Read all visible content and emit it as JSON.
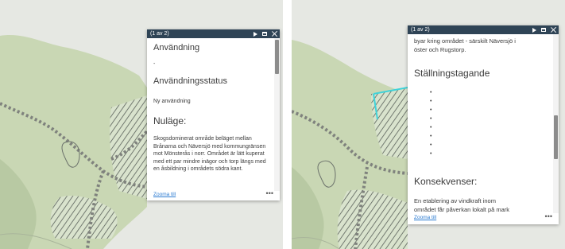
{
  "left_popup": {
    "counter": "(1 av 2)",
    "headings": [
      "Användning",
      "Användningsstatus",
      "Nuläge:"
    ],
    "anvandning_value": "-",
    "status_value": "Ny användning",
    "nulage_text": "Skogsdominerat område beläget mellan Brånarna och Näversjö med kommungränsen mot Mönsterås i norr. Området är lätt kuperat med ett par mindre inägor och torp längs med en åsbildning i områdets södra kant.",
    "zoom_link": "Zooma till"
  },
  "right_popup": {
    "counter": "(1 av 2)",
    "top_text_line1": "byar kring området - särskilt Näversjö i",
    "top_text_line2": "öster och Rugstorp.",
    "heading_stallning": "Ställningstagande",
    "bullet_count": 8,
    "heading_konsekvenser": "Konsekvenser:",
    "konsekvenser_line1": "En etablering av vindkraft inom",
    "konsekvenser_line2": "området får påverkan lokalt på mark",
    "zoom_link": "Zooma till"
  },
  "icons": [
    "play-icon",
    "maximize-icon",
    "close-icon",
    "more-icon"
  ],
  "colors": {
    "header_bg": "#2f4456",
    "link": "#2b7bd1",
    "map_green": "#c7d6b1",
    "map_bg": "#e6e8e3",
    "highlight": "#3fd3d9"
  }
}
